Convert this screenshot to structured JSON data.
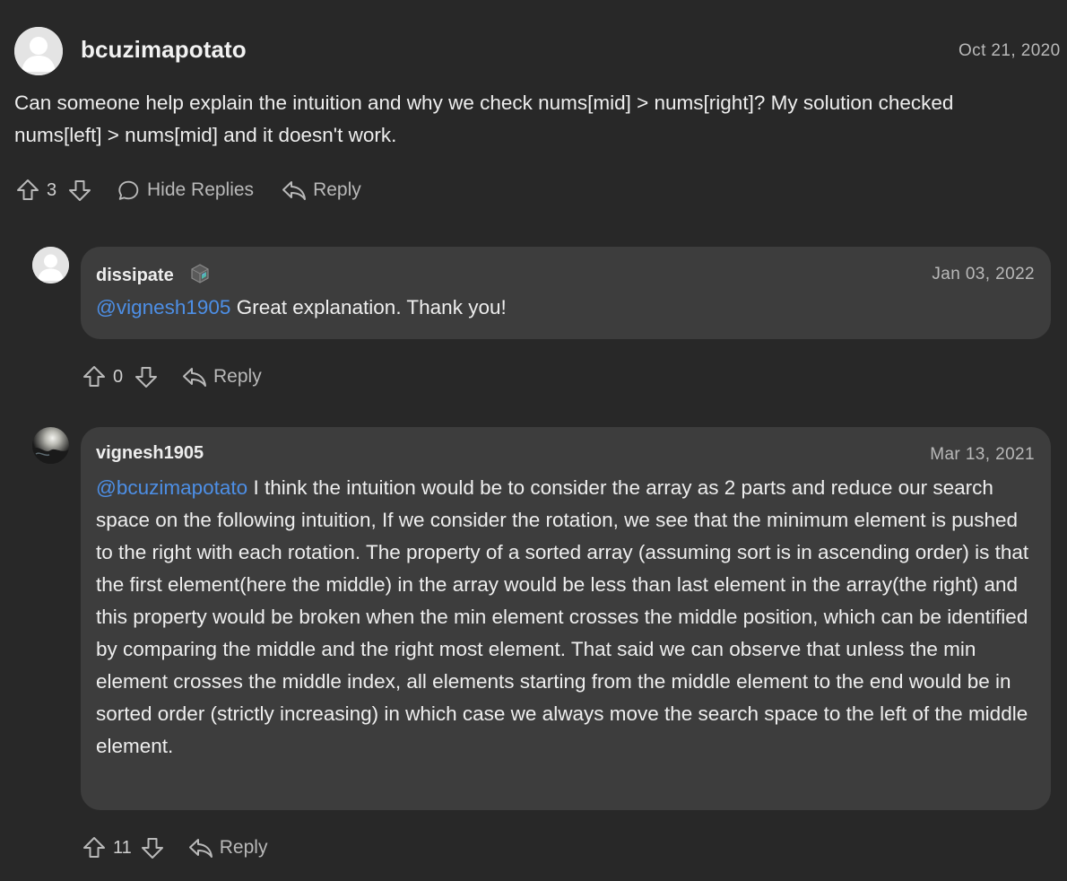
{
  "main_comment": {
    "username": "bcuzimapotato",
    "date": "Oct 21, 2020",
    "text": "Can someone help explain the intuition and why we check nums[mid] > nums[right]? My solution checked nums[left] > nums[mid] and it doesn't work.",
    "votes": "3",
    "hide_replies_label": "Hide Replies",
    "reply_label": "Reply"
  },
  "replies": [
    {
      "username": "dissipate",
      "date": "Jan 03, 2022",
      "mention": "@vignesh1905",
      "text": " Great explanation. Thank you!",
      "votes": "0",
      "reply_label": "Reply"
    },
    {
      "username": "vignesh1905",
      "date": "Mar 13, 2021",
      "mention": "@bcuzimapotato",
      "text": " I think the intuition would be to consider the array as 2 parts and reduce our search space on the following intuition, If we consider the rotation, we see that the minimum element is pushed to the right with each rotation. The property of a sorted array (assuming sort is in ascending order) is that the first element(here the middle) in the array would be less than last element in the array(the right) and this property would be broken when the min element crosses the middle position, which can be identified by comparing the middle and the right most element. That said we can observe that unless the min element crosses the middle index, all elements starting from the middle element to the end would be in sorted order (strictly increasing) in which case we always move the search space to the left of the middle element.",
      "votes": "11",
      "reply_label": "Reply"
    }
  ],
  "colors": {
    "background": "#282828",
    "reply_bubble": "#3d3d3d",
    "mention": "#4d8fe6",
    "text": "#eeeeee",
    "muted": "#b9b9b9"
  },
  "icons": {
    "upvote": "arrow-up-outline-icon",
    "downvote": "arrow-down-outline-icon",
    "hide_replies": "speech-bubble-icon",
    "reply": "reply-arrow-icon",
    "badge": "cube-badge-icon"
  }
}
